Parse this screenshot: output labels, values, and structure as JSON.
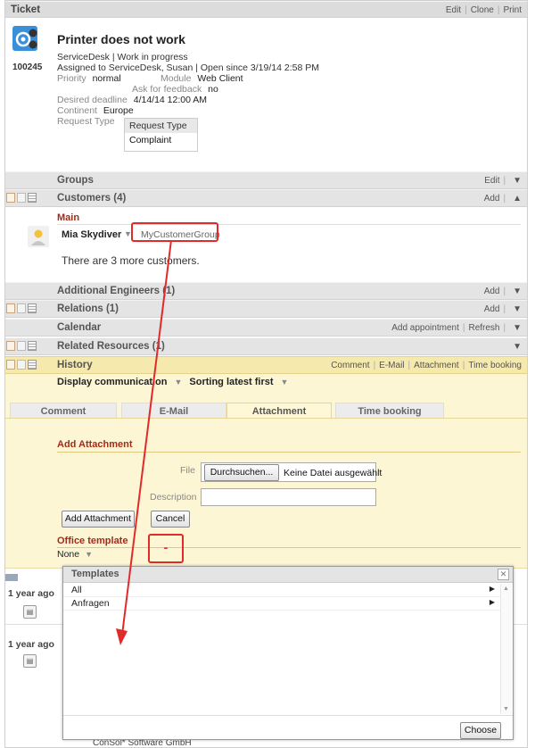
{
  "ticket_bar": {
    "title": "Ticket",
    "edit": "Edit",
    "clone": "Clone",
    "print": "Print"
  },
  "ticket": {
    "id": "100245",
    "name": "Printer does not work",
    "queue_status": "ServiceDesk | Work in progress",
    "assigned": "Assigned to ServiceDesk, Susan | Open since 3/19/14 2:58 PM",
    "priority_label": "Priority",
    "priority_value": "normal",
    "module_label": "Module",
    "module_value": "Web Client",
    "feedback_label": "Ask for feedback",
    "feedback_value": "no",
    "deadline_label": "Desired deadline",
    "deadline_value": "4/14/14 12:00 AM",
    "continent_label": "Continent",
    "continent_value": "Europe",
    "request_type_label": "Request Type",
    "request_type_header": "Request Type",
    "request_type_value": "Complaint"
  },
  "groups": {
    "title": "Groups",
    "edit": "Edit"
  },
  "customers": {
    "title": "Customers (4)",
    "add": "Add",
    "section": "Main",
    "customer_name": "Mia Skydiver",
    "customer_group": "MyCustomerGroup",
    "more": "There are 3 more customers."
  },
  "engineers": {
    "title": "Additional Engineers (1)",
    "add": "Add"
  },
  "relations": {
    "title": "Relations (1)",
    "add": "Add"
  },
  "calendar": {
    "title": "Calendar",
    "add_appointment": "Add appointment",
    "refresh": "Refresh"
  },
  "resources": {
    "title": "Related Resources (1)"
  },
  "history": {
    "title": "History",
    "comment": "Comment",
    "email": "E-Mail",
    "attachment": "Attachment",
    "time_booking": "Time booking",
    "display_filter": "Display communication",
    "sorting": "Sorting latest first",
    "tabs": [
      "Comment",
      "E-Mail",
      "Attachment",
      "Time booking"
    ]
  },
  "attachment_form": {
    "title": "Add Attachment",
    "file_label": "File",
    "browse": "Durchsuchen...",
    "no_file": "Keine Datei ausgewählt",
    "description_label": "Description",
    "add_button": "Add Attachment",
    "cancel_button": "Cancel",
    "office_template": "Office template",
    "office_template_value": "None",
    "marker": "-"
  },
  "timeline": {
    "entry1": "1 year ago",
    "entry2": "1 year ago",
    "footer": "ConSol* Software GmbH"
  },
  "templates_popup": {
    "title": "Templates",
    "items": [
      "All",
      "Anfragen"
    ],
    "choose": "Choose"
  },
  "colors": {
    "highlight": "#e12a2a",
    "section_red": "#a52a1a",
    "history_bg": "#fdf6d4"
  }
}
